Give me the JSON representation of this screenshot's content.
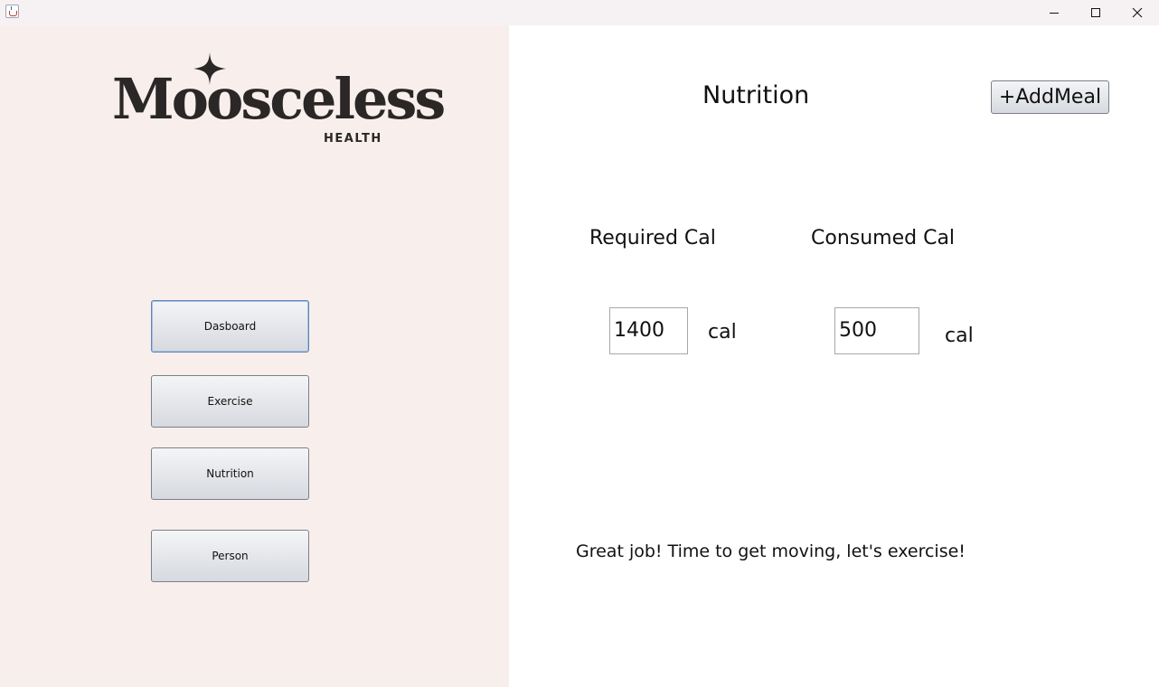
{
  "window": {
    "controls": {
      "minimize_icon": "minimize-icon",
      "maximize_icon": "maximize-icon",
      "close_icon": "close-icon"
    }
  },
  "sidebar": {
    "logo": {
      "wordmark": "Moosceless",
      "subtitle": "HEALTH"
    },
    "items": [
      {
        "label": "Dasboard",
        "focused": true
      },
      {
        "label": "Exercise",
        "focused": false
      },
      {
        "label": "Nutrition",
        "focused": false
      },
      {
        "label": "Person",
        "focused": false
      }
    ]
  },
  "main": {
    "title": "Nutrition",
    "add_meal_label": "+AddMeal",
    "required": {
      "label": "Required Cal",
      "value": "1400",
      "unit": "cal"
    },
    "consumed": {
      "label": "Consumed Cal",
      "value": "500",
      "unit": "cal"
    },
    "message": "Great job! Time to get moving, let's exercise!"
  },
  "colors": {
    "sidebar_bg": "#f8efec",
    "content_bg": "#ffffff",
    "titlebar_bg": "#f6f1f3",
    "logo_text": "#2a2726"
  }
}
